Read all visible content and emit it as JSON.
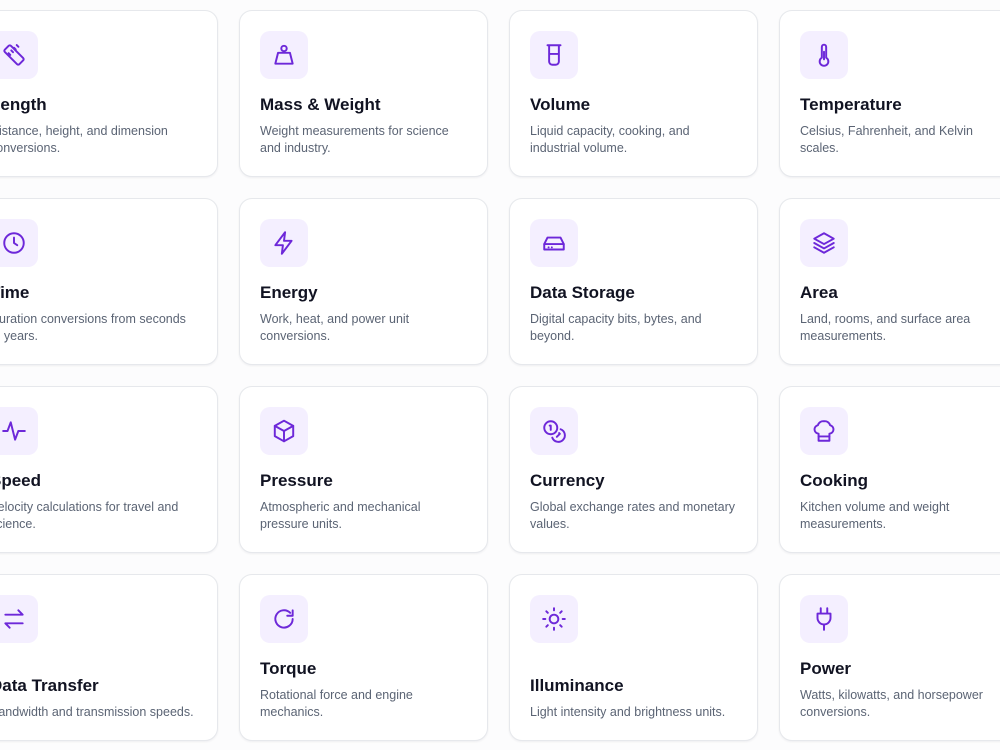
{
  "categories": [
    {
      "title": "Length",
      "description": "Distance, height, and dimension conversions.",
      "icon": "ruler-icon"
    },
    {
      "title": "Mass & Weight",
      "description": "Weight measurements for science and industry.",
      "icon": "weight-icon"
    },
    {
      "title": "Volume",
      "description": "Liquid capacity, cooking, and industrial volume.",
      "icon": "beaker-icon"
    },
    {
      "title": "Temperature",
      "description": "Celsius, Fahrenheit, and Kelvin scales.",
      "icon": "thermometer-icon"
    },
    {
      "title": "Time",
      "description": "Duration conversions from seconds to years.",
      "icon": "clock-icon"
    },
    {
      "title": "Energy",
      "description": "Work, heat, and power unit conversions.",
      "icon": "lightning-icon"
    },
    {
      "title": "Data Storage",
      "description": "Digital capacity bits, bytes, and beyond.",
      "icon": "hard-drive-icon"
    },
    {
      "title": "Area",
      "description": "Land, rooms, and surface area measurements.",
      "icon": "layers-icon"
    },
    {
      "title": "Speed",
      "description": "Velocity calculations for travel and science.",
      "icon": "pulse-icon"
    },
    {
      "title": "Pressure",
      "description": "Atmospheric and mechanical pressure units.",
      "icon": "cube-icon"
    },
    {
      "title": "Currency",
      "description": "Global exchange rates and monetary values.",
      "icon": "coins-icon"
    },
    {
      "title": "Cooking",
      "description": "Kitchen volume and weight measurements.",
      "icon": "chef-hat-icon"
    },
    {
      "title": "Data Transfer",
      "description": "Bandwidth and transmission speeds.",
      "icon": "arrows-exchange-icon"
    },
    {
      "title": "Torque",
      "description": "Rotational force and engine mechanics.",
      "icon": "rotate-icon"
    },
    {
      "title": "Illuminance",
      "description": "Light intensity and brightness units.",
      "icon": "sun-icon"
    },
    {
      "title": "Power",
      "description": "Watts, kilowatts, and horsepower conversions.",
      "icon": "plug-icon"
    }
  ],
  "colors": {
    "accent": "#6d28d9",
    "icon_background": "#f4efff",
    "title": "#111322",
    "description": "#5b6474",
    "card_border": "#e6e8ec"
  }
}
